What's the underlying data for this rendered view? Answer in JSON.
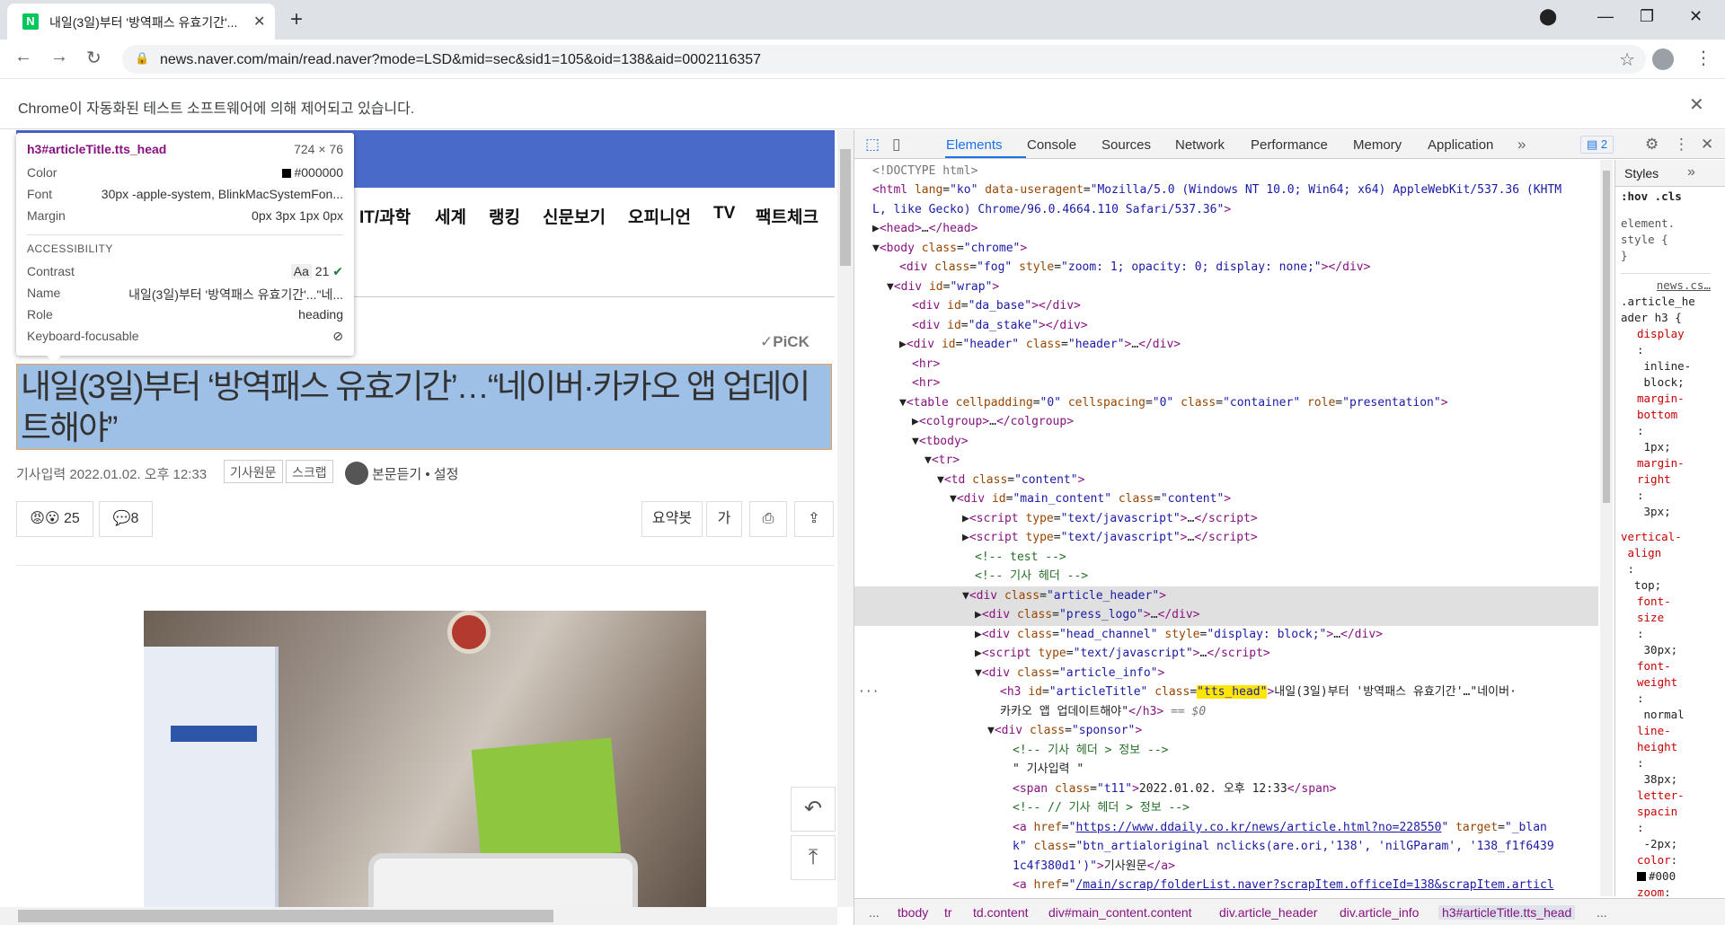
{
  "browser": {
    "tab_title": "내일(3일)부터 '방역패스 유효기간'...",
    "tab_favicon": "N",
    "url": "news.naver.com/main/read.naver?mode=LSD&mid=sec&sid1=105&oid=138&aid=0002116357",
    "infobar_message": "Chrome이 자동화된 테스트 소프트웨어에 의해 제어되고 있습니다."
  },
  "page": {
    "nav": [
      "IT/과학",
      "세계",
      "랭킹",
      "신문보기",
      "오피니언",
      "TV",
      "팩트체크"
    ],
    "pick_label": "✓PiCK",
    "headline": "내일(3일)부터 ‘방역패스 유효기간’…“네이버·카카오 앱 업데이트해야”",
    "meta_label": "기사입력 2022.01.02. 오후 12:33",
    "original_btn": "기사원문",
    "scrap_btn": "스크랩",
    "tts_label": "본문듣기 • 설정",
    "reaction_count": "25",
    "comment_count": "8",
    "summary_btn": "요약봇",
    "font_btn": "가"
  },
  "tooltip": {
    "selector": "h3#articleTitle.tts_head",
    "size": "724 × 76",
    "color_label": "Color",
    "color_value": "#000000",
    "font_label": "Font",
    "font_value": "30px -apple-system, BlinkMacSystemFon...",
    "margin_label": "Margin",
    "margin_value": "0px 3px 1px 0px",
    "accessibility_label": "ACCESSIBILITY",
    "contrast_label": "Contrast",
    "contrast_value": "21",
    "name_label": "Name",
    "name_value": "내일(3일)부터 '방역패스 유효기간'...\"네...",
    "role_label": "Role",
    "role_value": "heading",
    "focus_label": "Keyboard-focusable"
  },
  "devtools": {
    "tabs": [
      "Elements",
      "Console",
      "Sources",
      "Network",
      "Performance",
      "Memory",
      "Application"
    ],
    "active_tab": "Elements",
    "issues_count": "2",
    "styles_tab": "Styles",
    "hov": ":hov",
    "cls": ".cls",
    "breadcrumbs": [
      "...",
      "tbody",
      "tr",
      "td.content",
      "div#main_content.content",
      "div.article_header",
      "div.article_info",
      "h3#articleTitle.tts_head",
      "..."
    ]
  },
  "colors": {
    "naver_blue": "#4a6ac9",
    "selection_highlight": "#9fc0e6",
    "devtools_accent": "#1a73e8"
  }
}
